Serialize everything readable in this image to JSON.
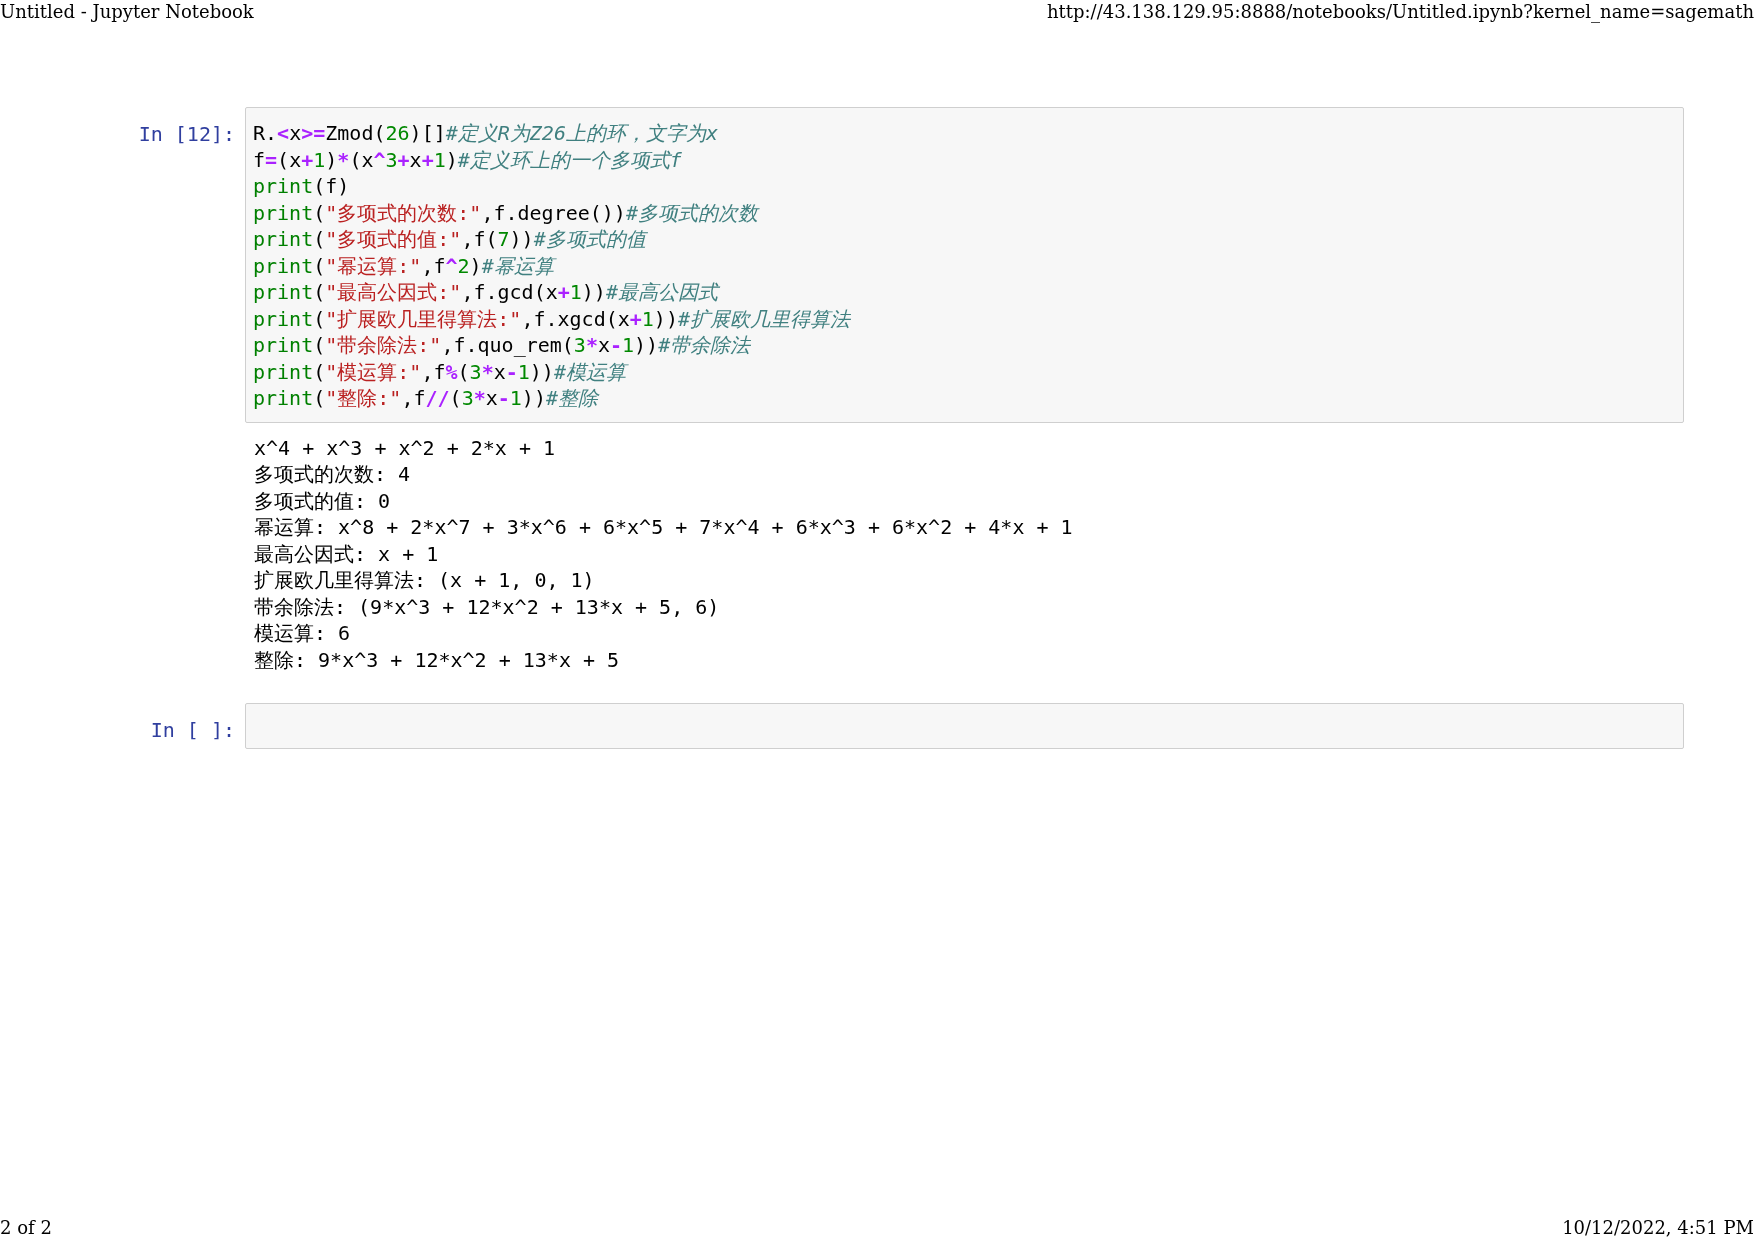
{
  "header": {
    "title": "Untitled - Jupyter Notebook",
    "url": "http://43.138.129.95:8888/notebooks/Untitled.ipynb?kernel_name=sagemath"
  },
  "cells": [
    {
      "prompt": "In [12]:",
      "code": [
        {
          "tokens": [
            {
              "kind": "name",
              "text": "R."
            },
            {
              "kind": "operator",
              "text": "<"
            },
            {
              "kind": "name",
              "text": "x"
            },
            {
              "kind": "operator",
              "text": ">="
            },
            {
              "kind": "name",
              "text": "Zmod("
            },
            {
              "kind": "number",
              "text": "26"
            },
            {
              "kind": "name",
              "text": ")[]"
            },
            {
              "kind": "comment",
              "text": "#定义R为Z26上的环，文字为x"
            }
          ]
        },
        {
          "tokens": [
            {
              "kind": "name",
              "text": "f"
            },
            {
              "kind": "operator",
              "text": "="
            },
            {
              "kind": "name",
              "text": "(x"
            },
            {
              "kind": "operator",
              "text": "+"
            },
            {
              "kind": "number",
              "text": "1"
            },
            {
              "kind": "name",
              "text": ")"
            },
            {
              "kind": "operator",
              "text": "*"
            },
            {
              "kind": "name",
              "text": "(x"
            },
            {
              "kind": "operator",
              "text": "^"
            },
            {
              "kind": "number",
              "text": "3"
            },
            {
              "kind": "operator",
              "text": "+"
            },
            {
              "kind": "name",
              "text": "x"
            },
            {
              "kind": "operator",
              "text": "+"
            },
            {
              "kind": "number",
              "text": "1"
            },
            {
              "kind": "name",
              "text": ")"
            },
            {
              "kind": "comment",
              "text": "#定义环上的一个多项式f"
            }
          ]
        },
        {
          "tokens": [
            {
              "kind": "builtin",
              "text": "print"
            },
            {
              "kind": "name",
              "text": "(f)"
            }
          ]
        },
        {
          "tokens": [
            {
              "kind": "builtin",
              "text": "print"
            },
            {
              "kind": "name",
              "text": "("
            },
            {
              "kind": "string",
              "text": "\"多项式的次数:\""
            },
            {
              "kind": "name",
              "text": ",f.degree())"
            },
            {
              "kind": "comment",
              "text": "#多项式的次数"
            }
          ]
        },
        {
          "tokens": [
            {
              "kind": "builtin",
              "text": "print"
            },
            {
              "kind": "name",
              "text": "("
            },
            {
              "kind": "string",
              "text": "\"多项式的值:\""
            },
            {
              "kind": "name",
              "text": ",f("
            },
            {
              "kind": "number",
              "text": "7"
            },
            {
              "kind": "name",
              "text": "))"
            },
            {
              "kind": "comment",
              "text": "#多项式的值"
            }
          ]
        },
        {
          "tokens": [
            {
              "kind": "builtin",
              "text": "print"
            },
            {
              "kind": "name",
              "text": "("
            },
            {
              "kind": "string",
              "text": "\"幂运算:\""
            },
            {
              "kind": "name",
              "text": ",f"
            },
            {
              "kind": "operator",
              "text": "^"
            },
            {
              "kind": "number",
              "text": "2"
            },
            {
              "kind": "name",
              "text": ")"
            },
            {
              "kind": "comment",
              "text": "#幂运算"
            }
          ]
        },
        {
          "tokens": [
            {
              "kind": "builtin",
              "text": "print"
            },
            {
              "kind": "name",
              "text": "("
            },
            {
              "kind": "string",
              "text": "\"最高公因式:\""
            },
            {
              "kind": "name",
              "text": ",f.gcd(x"
            },
            {
              "kind": "operator",
              "text": "+"
            },
            {
              "kind": "number",
              "text": "1"
            },
            {
              "kind": "name",
              "text": "))"
            },
            {
              "kind": "comment",
              "text": "#最高公因式"
            }
          ]
        },
        {
          "tokens": [
            {
              "kind": "builtin",
              "text": "print"
            },
            {
              "kind": "name",
              "text": "("
            },
            {
              "kind": "string",
              "text": "\"扩展欧几里得算法:\""
            },
            {
              "kind": "name",
              "text": ",f.xgcd(x"
            },
            {
              "kind": "operator",
              "text": "+"
            },
            {
              "kind": "number",
              "text": "1"
            },
            {
              "kind": "name",
              "text": "))"
            },
            {
              "kind": "comment",
              "text": "#扩展欧几里得算法"
            }
          ]
        },
        {
          "tokens": [
            {
              "kind": "builtin",
              "text": "print"
            },
            {
              "kind": "name",
              "text": "("
            },
            {
              "kind": "string",
              "text": "\"带余除法:\""
            },
            {
              "kind": "name",
              "text": ",f.quo_rem("
            },
            {
              "kind": "number",
              "text": "3"
            },
            {
              "kind": "operator",
              "text": "*"
            },
            {
              "kind": "name",
              "text": "x"
            },
            {
              "kind": "operator",
              "text": "-"
            },
            {
              "kind": "number",
              "text": "1"
            },
            {
              "kind": "name",
              "text": "))"
            },
            {
              "kind": "comment",
              "text": "#带余除法"
            }
          ]
        },
        {
          "tokens": [
            {
              "kind": "builtin",
              "text": "print"
            },
            {
              "kind": "name",
              "text": "("
            },
            {
              "kind": "string",
              "text": "\"模运算:\""
            },
            {
              "kind": "name",
              "text": ",f"
            },
            {
              "kind": "operator",
              "text": "%"
            },
            {
              "kind": "name",
              "text": "("
            },
            {
              "kind": "number",
              "text": "3"
            },
            {
              "kind": "operator",
              "text": "*"
            },
            {
              "kind": "name",
              "text": "x"
            },
            {
              "kind": "operator",
              "text": "-"
            },
            {
              "kind": "number",
              "text": "1"
            },
            {
              "kind": "name",
              "text": "))"
            },
            {
              "kind": "comment",
              "text": "#模运算"
            }
          ]
        },
        {
          "tokens": [
            {
              "kind": "builtin",
              "text": "print"
            },
            {
              "kind": "name",
              "text": "("
            },
            {
              "kind": "string",
              "text": "\"整除:\""
            },
            {
              "kind": "name",
              "text": ",f"
            },
            {
              "kind": "operator",
              "text": "//"
            },
            {
              "kind": "name",
              "text": "("
            },
            {
              "kind": "number",
              "text": "3"
            },
            {
              "kind": "operator",
              "text": "*"
            },
            {
              "kind": "name",
              "text": "x"
            },
            {
              "kind": "operator",
              "text": "-"
            },
            {
              "kind": "number",
              "text": "1"
            },
            {
              "kind": "name",
              "text": "))"
            },
            {
              "kind": "comment",
              "text": "#整除"
            }
          ]
        }
      ],
      "output": [
        "x^4 + x^3 + x^2 + 2*x + 1",
        "多项式的次数: 4",
        "多项式的值: 0",
        "幂运算: x^8 + 2*x^7 + 3*x^6 + 6*x^5 + 7*x^4 + 6*x^3 + 6*x^2 + 4*x + 1",
        "最高公因式: x + 1",
        "扩展欧几里得算法: (x + 1, 0, 1)",
        "带余除法: (9*x^3 + 12*x^2 + 13*x + 5, 6)",
        "模运算: 6",
        "整除: 9*x^3 + 12*x^2 + 13*x + 5"
      ]
    },
    {
      "prompt": "In [ ]:"
    }
  ],
  "footer": {
    "page": "2 of 2",
    "datetime": "10/12/2022, 4:51 PM"
  }
}
